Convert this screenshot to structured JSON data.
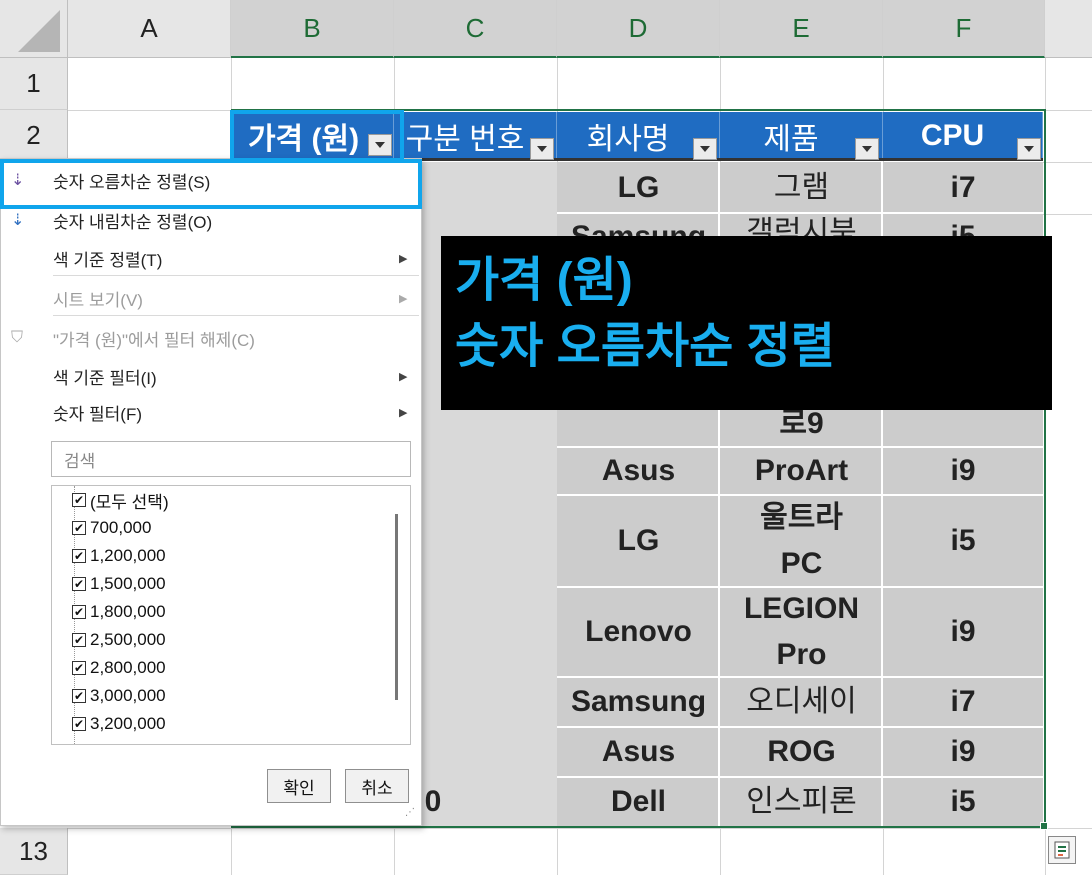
{
  "columns": [
    "A",
    "B",
    "C",
    "D",
    "E",
    "F"
  ],
  "rows": [
    "1",
    "2",
    "13"
  ],
  "table": {
    "headers": [
      "가격 (원)",
      "구분 번호",
      "회사명",
      "제품",
      "CPU"
    ],
    "visible_rows": [
      {
        "company": "LG",
        "product": "그램",
        "cpu": "i7"
      },
      {
        "company": "Samsung",
        "product": "갤럭시북",
        "cpu": "i5"
      },
      {
        "company": "",
        "product": "로9",
        "cpu": ""
      },
      {
        "company": "Asus",
        "product": "ProArt",
        "cpu": "i9"
      },
      {
        "company": "LG",
        "product": "울트라 PC",
        "cpu": "i5"
      },
      {
        "company": "Lenovo",
        "product": "LEGION Pro",
        "cpu": "i9"
      },
      {
        "company": "Samsung",
        "product": "오디세이",
        "cpu": "i7"
      },
      {
        "company": "Asus",
        "product": "ROG",
        "cpu": "i9"
      },
      {
        "company": "Dell",
        "product": "인스피론",
        "cpu": "i5"
      }
    ],
    "partial_c_last": "0"
  },
  "filter_menu": {
    "sort_asc": "숫자 오름차순 정렬(S)",
    "sort_desc": "숫자 내림차순 정렬(O)",
    "sort_by_color": "색 기준 정렬(T)",
    "sheet_view": "시트 보기(V)",
    "clear_filter": "\"가격 (원)\"에서 필터 해제(C)",
    "filter_by_color": "색 기준 필터(I)",
    "number_filters": "숫자 필터(F)",
    "search_placeholder": "검색",
    "items": [
      "(모두 선택)",
      "700,000",
      "1,200,000",
      "1,500,000",
      "1,800,000",
      "2,500,000",
      "2,800,000",
      "3,000,000",
      "3,200,000"
    ],
    "ok": "확인",
    "cancel": "취소"
  },
  "overlay": {
    "line1": "가격 (원)",
    "line2": "숫자 오름차순 정렬"
  },
  "colors": {
    "header_blue": "#1f6cc2",
    "highlight_cyan": "#10a5ec",
    "overlay_text": "#19aeef",
    "excel_green": "#217346"
  }
}
